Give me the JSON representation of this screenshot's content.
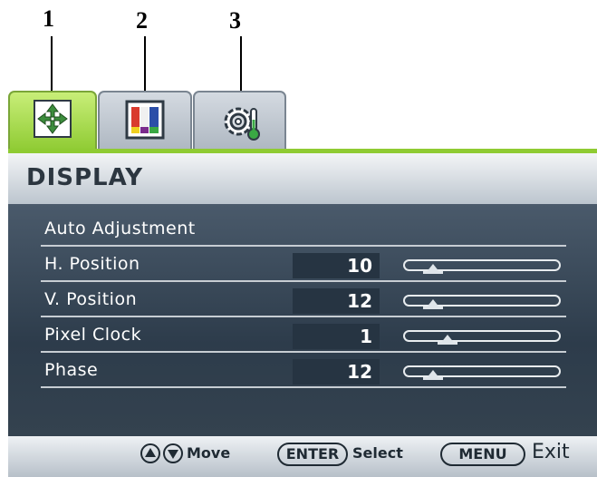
{
  "callouts": [
    "1",
    "2",
    "3"
  ],
  "tabs": [
    {
      "name": "display",
      "icon": "display-arrows-icon",
      "active": true
    },
    {
      "name": "picture",
      "icon": "color-bars-icon",
      "active": false
    },
    {
      "name": "system",
      "icon": "gear-thermometer-icon",
      "active": false
    }
  ],
  "title": "DISPLAY",
  "menu": {
    "items": [
      {
        "label": "Auto Adjustment",
        "value": null
      },
      {
        "label": "H. Position",
        "value": "10",
        "level": 0.15
      },
      {
        "label": "V. Position",
        "value": "12",
        "level": 0.15
      },
      {
        "label": "Pixel Clock",
        "value": "1",
        "level": 0.25
      },
      {
        "label": "Phase",
        "value": "12",
        "level": 0.15
      }
    ]
  },
  "footer": {
    "up_icon": "up-arrow-icon",
    "down_icon": "down-arrow-icon",
    "move_label": "Move",
    "enter_label": "ENTER",
    "select_label": "Select",
    "menu_label": "MENU",
    "exit_label": "Exit"
  },
  "colors": {
    "active_tab": "#8fcb33",
    "panel": "#2d3c4b",
    "title_text": "#2c3640"
  }
}
